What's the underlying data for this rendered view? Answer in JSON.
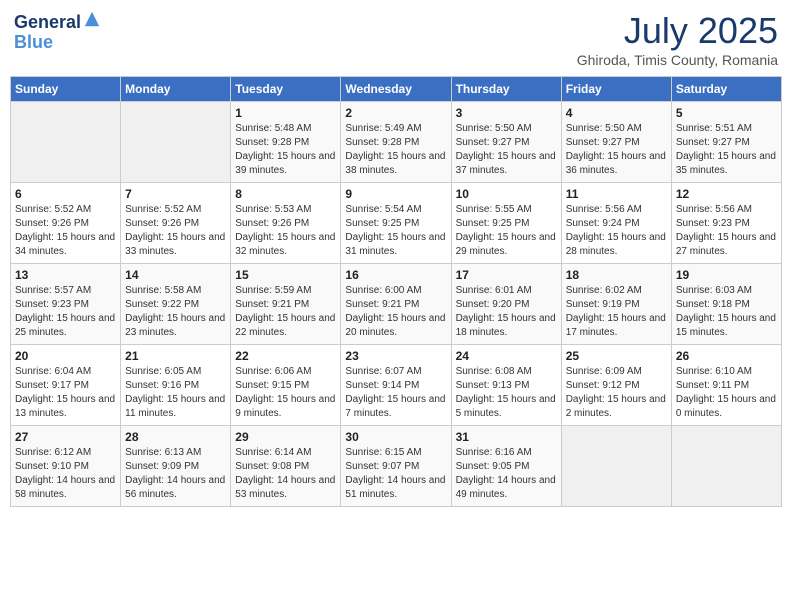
{
  "header": {
    "logo_line1": "General",
    "logo_line2": "Blue",
    "month_year": "July 2025",
    "location": "Ghiroda, Timis County, Romania"
  },
  "calendar": {
    "days_of_week": [
      "Sunday",
      "Monday",
      "Tuesday",
      "Wednesday",
      "Thursday",
      "Friday",
      "Saturday"
    ],
    "weeks": [
      [
        {
          "day": "",
          "info": ""
        },
        {
          "day": "",
          "info": ""
        },
        {
          "day": "1",
          "info": "Sunrise: 5:48 AM\nSunset: 9:28 PM\nDaylight: 15 hours and 39 minutes."
        },
        {
          "day": "2",
          "info": "Sunrise: 5:49 AM\nSunset: 9:28 PM\nDaylight: 15 hours and 38 minutes."
        },
        {
          "day": "3",
          "info": "Sunrise: 5:50 AM\nSunset: 9:27 PM\nDaylight: 15 hours and 37 minutes."
        },
        {
          "day": "4",
          "info": "Sunrise: 5:50 AM\nSunset: 9:27 PM\nDaylight: 15 hours and 36 minutes."
        },
        {
          "day": "5",
          "info": "Sunrise: 5:51 AM\nSunset: 9:27 PM\nDaylight: 15 hours and 35 minutes."
        }
      ],
      [
        {
          "day": "6",
          "info": "Sunrise: 5:52 AM\nSunset: 9:26 PM\nDaylight: 15 hours and 34 minutes."
        },
        {
          "day": "7",
          "info": "Sunrise: 5:52 AM\nSunset: 9:26 PM\nDaylight: 15 hours and 33 minutes."
        },
        {
          "day": "8",
          "info": "Sunrise: 5:53 AM\nSunset: 9:26 PM\nDaylight: 15 hours and 32 minutes."
        },
        {
          "day": "9",
          "info": "Sunrise: 5:54 AM\nSunset: 9:25 PM\nDaylight: 15 hours and 31 minutes."
        },
        {
          "day": "10",
          "info": "Sunrise: 5:55 AM\nSunset: 9:25 PM\nDaylight: 15 hours and 29 minutes."
        },
        {
          "day": "11",
          "info": "Sunrise: 5:56 AM\nSunset: 9:24 PM\nDaylight: 15 hours and 28 minutes."
        },
        {
          "day": "12",
          "info": "Sunrise: 5:56 AM\nSunset: 9:23 PM\nDaylight: 15 hours and 27 minutes."
        }
      ],
      [
        {
          "day": "13",
          "info": "Sunrise: 5:57 AM\nSunset: 9:23 PM\nDaylight: 15 hours and 25 minutes."
        },
        {
          "day": "14",
          "info": "Sunrise: 5:58 AM\nSunset: 9:22 PM\nDaylight: 15 hours and 23 minutes."
        },
        {
          "day": "15",
          "info": "Sunrise: 5:59 AM\nSunset: 9:21 PM\nDaylight: 15 hours and 22 minutes."
        },
        {
          "day": "16",
          "info": "Sunrise: 6:00 AM\nSunset: 9:21 PM\nDaylight: 15 hours and 20 minutes."
        },
        {
          "day": "17",
          "info": "Sunrise: 6:01 AM\nSunset: 9:20 PM\nDaylight: 15 hours and 18 minutes."
        },
        {
          "day": "18",
          "info": "Sunrise: 6:02 AM\nSunset: 9:19 PM\nDaylight: 15 hours and 17 minutes."
        },
        {
          "day": "19",
          "info": "Sunrise: 6:03 AM\nSunset: 9:18 PM\nDaylight: 15 hours and 15 minutes."
        }
      ],
      [
        {
          "day": "20",
          "info": "Sunrise: 6:04 AM\nSunset: 9:17 PM\nDaylight: 15 hours and 13 minutes."
        },
        {
          "day": "21",
          "info": "Sunrise: 6:05 AM\nSunset: 9:16 PM\nDaylight: 15 hours and 11 minutes."
        },
        {
          "day": "22",
          "info": "Sunrise: 6:06 AM\nSunset: 9:15 PM\nDaylight: 15 hours and 9 minutes."
        },
        {
          "day": "23",
          "info": "Sunrise: 6:07 AM\nSunset: 9:14 PM\nDaylight: 15 hours and 7 minutes."
        },
        {
          "day": "24",
          "info": "Sunrise: 6:08 AM\nSunset: 9:13 PM\nDaylight: 15 hours and 5 minutes."
        },
        {
          "day": "25",
          "info": "Sunrise: 6:09 AM\nSunset: 9:12 PM\nDaylight: 15 hours and 2 minutes."
        },
        {
          "day": "26",
          "info": "Sunrise: 6:10 AM\nSunset: 9:11 PM\nDaylight: 15 hours and 0 minutes."
        }
      ],
      [
        {
          "day": "27",
          "info": "Sunrise: 6:12 AM\nSunset: 9:10 PM\nDaylight: 14 hours and 58 minutes."
        },
        {
          "day": "28",
          "info": "Sunrise: 6:13 AM\nSunset: 9:09 PM\nDaylight: 14 hours and 56 minutes."
        },
        {
          "day": "29",
          "info": "Sunrise: 6:14 AM\nSunset: 9:08 PM\nDaylight: 14 hours and 53 minutes."
        },
        {
          "day": "30",
          "info": "Sunrise: 6:15 AM\nSunset: 9:07 PM\nDaylight: 14 hours and 51 minutes."
        },
        {
          "day": "31",
          "info": "Sunrise: 6:16 AM\nSunset: 9:05 PM\nDaylight: 14 hours and 49 minutes."
        },
        {
          "day": "",
          "info": ""
        },
        {
          "day": "",
          "info": ""
        }
      ]
    ]
  }
}
